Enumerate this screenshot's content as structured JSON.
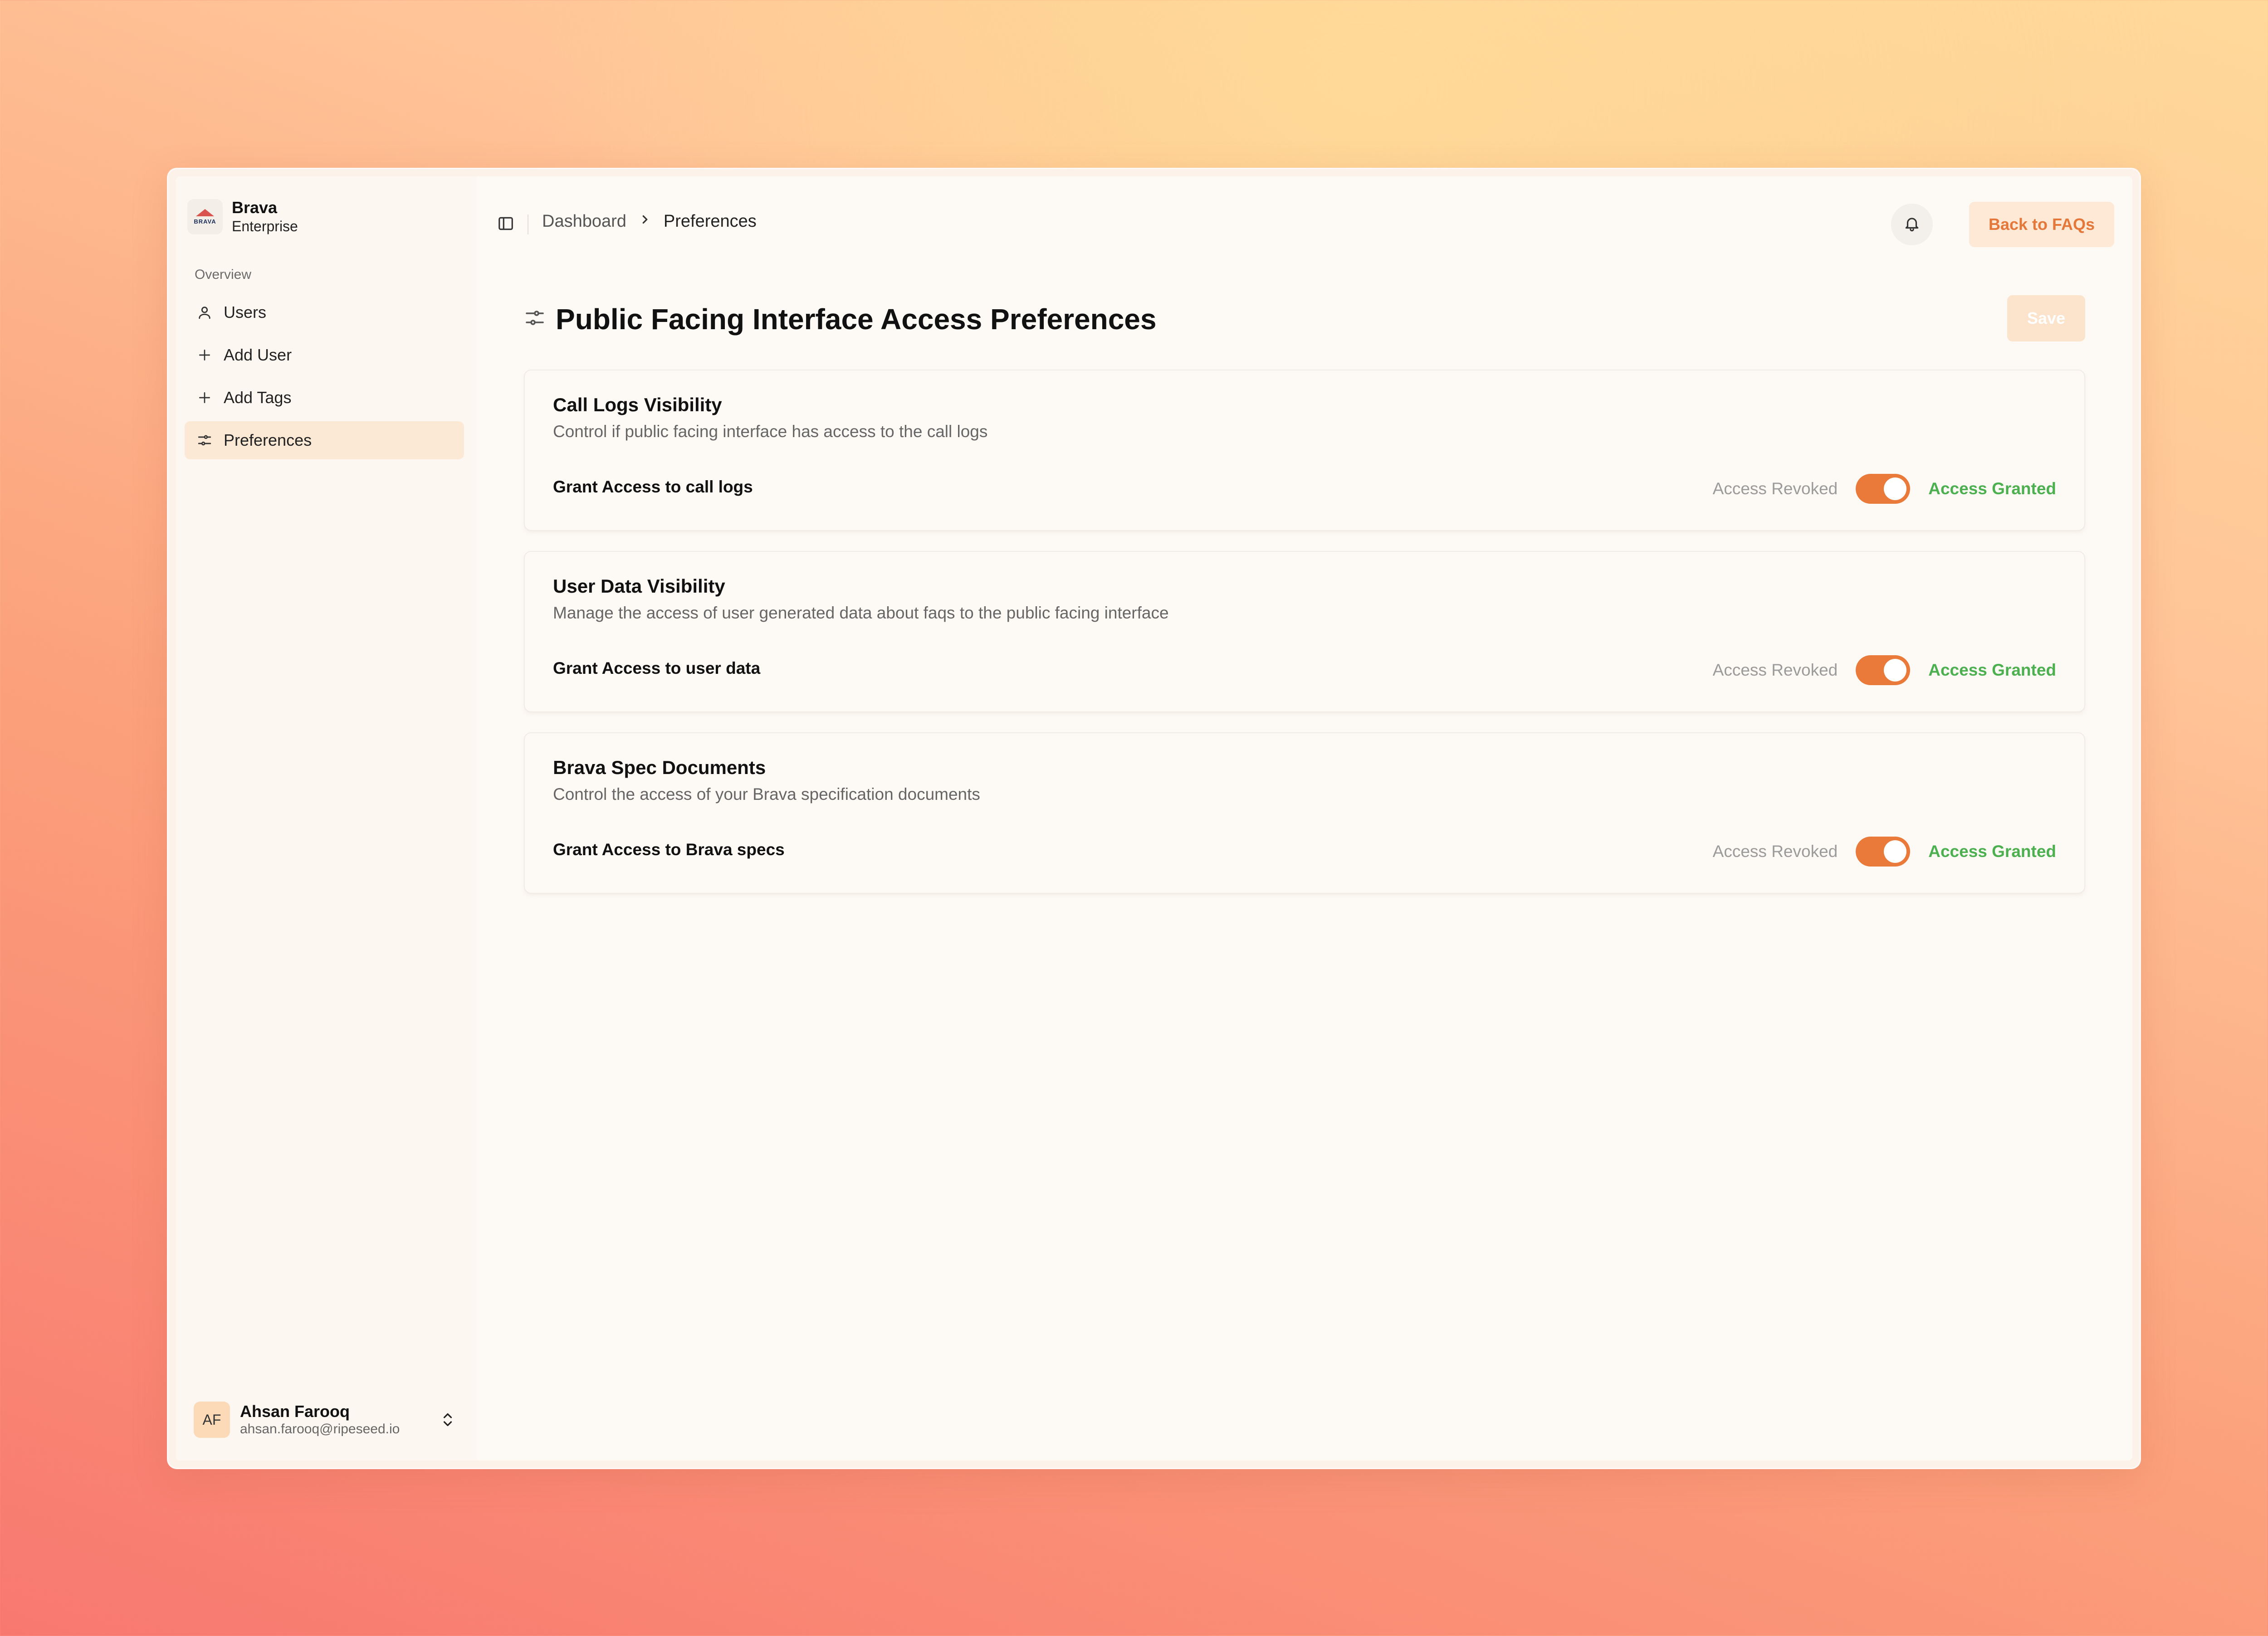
{
  "brand": {
    "name": "Brava",
    "subtitle": "Enterprise",
    "logo_text": "BRAVA"
  },
  "sidebar": {
    "section_label": "Overview",
    "items": [
      {
        "label": "Users",
        "icon": "user-icon"
      },
      {
        "label": "Add User",
        "icon": "plus-icon"
      },
      {
        "label": "Add Tags",
        "icon": "plus-icon"
      },
      {
        "label": "Preferences",
        "icon": "sliders-icon",
        "active": true
      }
    ]
  },
  "user": {
    "initials": "AF",
    "name": "Ahsan Farooq",
    "email": "ahsan.farooq@ripeseed.io"
  },
  "header": {
    "breadcrumb": {
      "parent": "Dashboard",
      "current": "Preferences"
    },
    "back_label": "Back to FAQs"
  },
  "page": {
    "title": "Public Facing Interface Access Preferences",
    "save_label": "Save"
  },
  "cards": [
    {
      "title": "Call Logs Visibility",
      "description": "Control if public facing interface has access to the call logs",
      "label": "Grant Access to call logs",
      "off_label": "Access Revoked",
      "on_label": "Access Granted",
      "enabled": true
    },
    {
      "title": "User Data Visibility",
      "description": "Manage the access of user generated data about faqs to the public facing interface",
      "label": "Grant Access to user data",
      "off_label": "Access Revoked",
      "on_label": "Access Granted",
      "enabled": true
    },
    {
      "title": "Brava Spec Documents",
      "description": "Control the access of your Brava specification documents",
      "label": "Grant Access to Brava specs",
      "off_label": "Access Revoked",
      "on_label": "Access Granted",
      "enabled": true
    }
  ],
  "colors": {
    "accent": "#e97a3a",
    "granted": "#4caf50",
    "active_nav_bg": "#fbe9d6"
  }
}
